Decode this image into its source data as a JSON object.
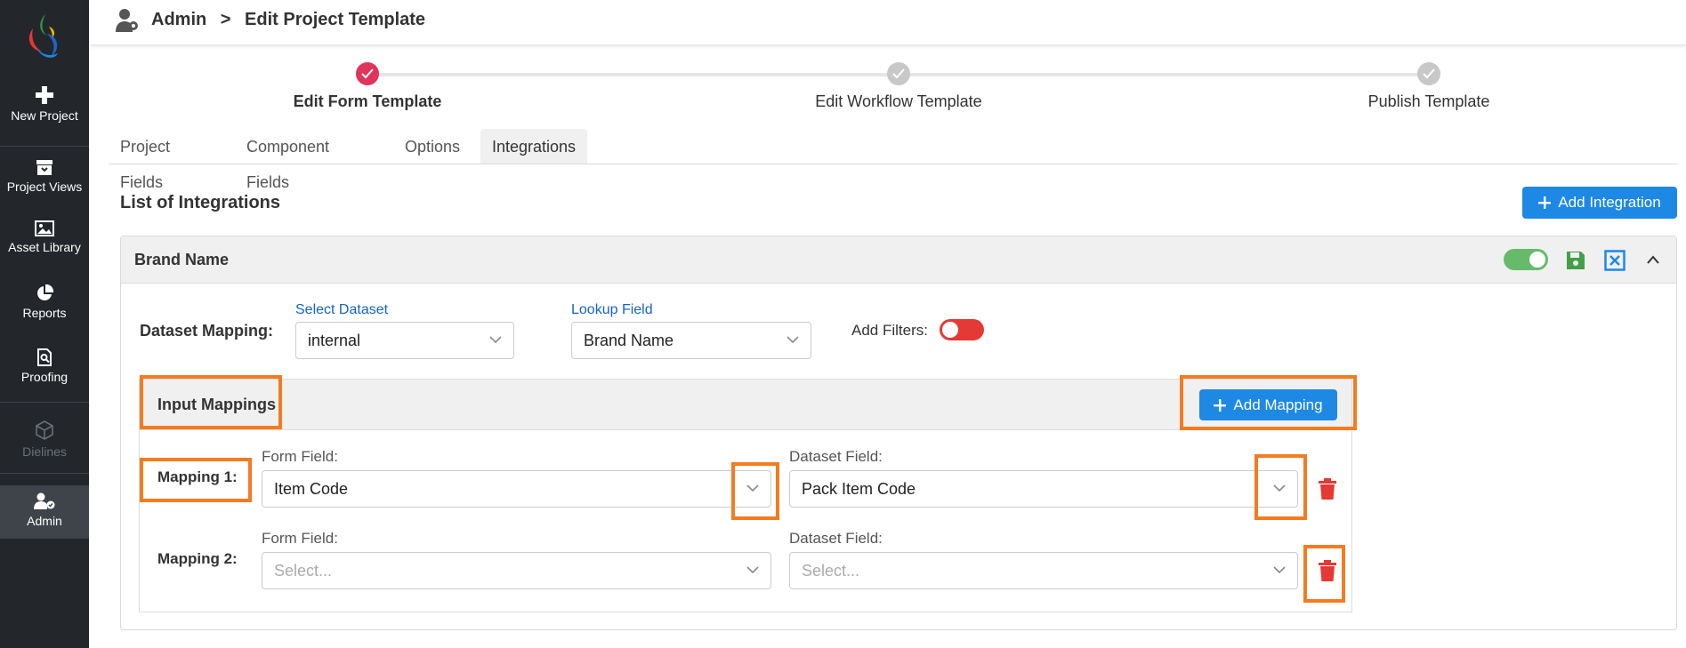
{
  "sidebar": {
    "items": [
      {
        "label": "New Project",
        "icon": "plus-icon"
      },
      {
        "label": "Project Views",
        "icon": "archive-icon"
      },
      {
        "label": "Asset Library",
        "icon": "image-icon"
      },
      {
        "label": "Reports",
        "icon": "pie-chart-icon"
      },
      {
        "label": "Proofing",
        "icon": "proof-search-icon"
      },
      {
        "label": "Dielines",
        "icon": "cube-icon"
      },
      {
        "label": "Admin",
        "icon": "admin-user-icon"
      }
    ]
  },
  "header": {
    "breadcrumb_root": "Admin",
    "breadcrumb_sep": ">",
    "breadcrumb_page": "Edit Project Template"
  },
  "stepper": {
    "steps": [
      {
        "label": "Edit Form Template",
        "state": "done"
      },
      {
        "label": "Edit Workflow Template",
        "state": "pending"
      },
      {
        "label": "Publish Template",
        "state": "pending"
      }
    ]
  },
  "tabs": [
    {
      "label": "Project Fields"
    },
    {
      "label": "Component Fields"
    },
    {
      "label": "Options"
    },
    {
      "label": "Integrations"
    }
  ],
  "integrations": {
    "title": "List of Integrations",
    "add_button": "Add Integration",
    "card": {
      "name": "Brand Name",
      "enabled": true,
      "dataset_mapping_label": "Dataset Mapping:",
      "select_dataset_label": "Select Dataset",
      "select_dataset_value": "internal",
      "lookup_field_label": "Lookup Field",
      "lookup_field_value": "Brand Name",
      "add_filters_label": "Add Filters:",
      "add_filters_on": false,
      "input_mappings_title": "Input Mappings",
      "add_mapping_button": "Add Mapping",
      "mappings": [
        {
          "label": "Mapping 1:",
          "form_field_label": "Form Field:",
          "form_field_value": "Item Code",
          "dataset_field_label": "Dataset Field:",
          "dataset_field_value": "Pack Item Code"
        },
        {
          "label": "Mapping 2:",
          "form_field_label": "Form Field:",
          "form_field_value": "Select...",
          "dataset_field_label": "Dataset Field:",
          "dataset_field_value": "Select..."
        }
      ]
    }
  },
  "colors": {
    "accent": "#1e88e5",
    "highlight": "#f47b20",
    "danger": "#e53935",
    "success": "#43a047",
    "toggle_on": "#66bb6a"
  }
}
